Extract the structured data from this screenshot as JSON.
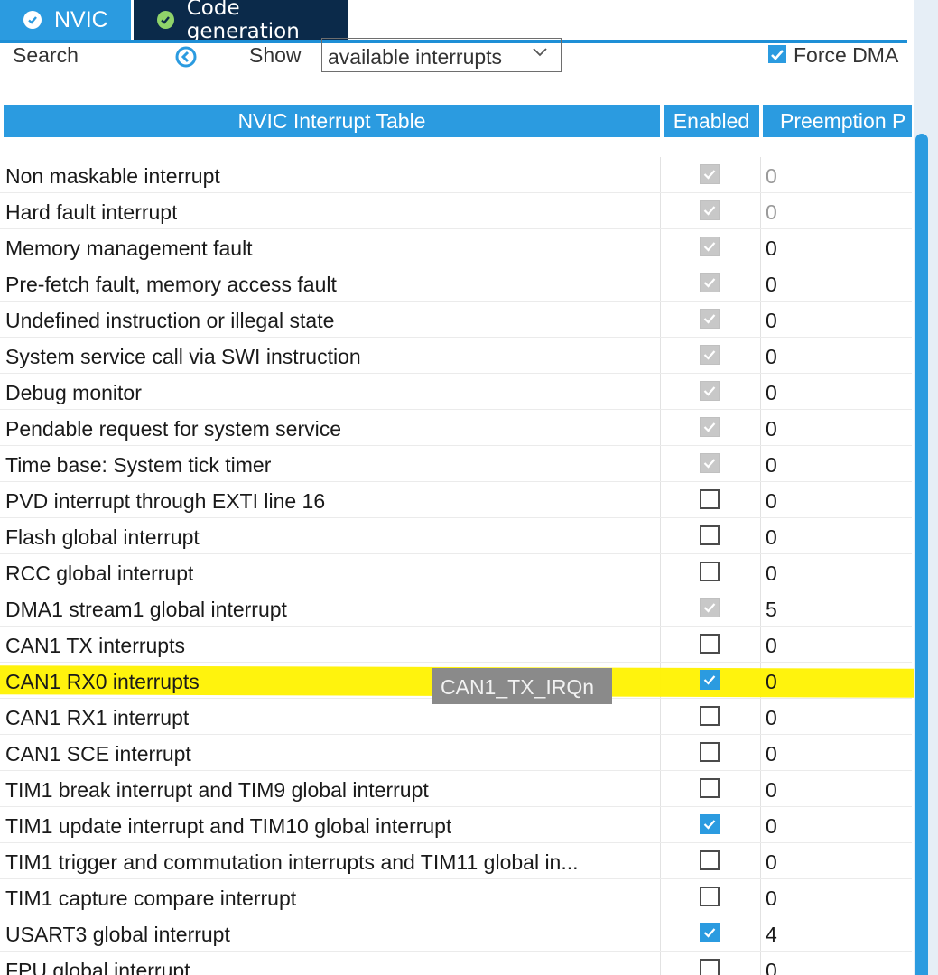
{
  "tabs": [
    {
      "label": "NVIC",
      "icon": "check-circle-icon"
    },
    {
      "label": "Code generation",
      "icon": "check-circle-icon"
    }
  ],
  "toolbar": {
    "search_label": "Search",
    "show_label": "Show",
    "show_value": "available interrupts",
    "force_dma_label": "Force DMA",
    "force_dma_checked": true
  },
  "table": {
    "headers": [
      "NVIC Interrupt Table",
      "Enabled",
      "Preemption P"
    ],
    "rows": [
      {
        "name": "Non maskable interrupt",
        "enabled": "disabled-checked",
        "priority": "0"
      },
      {
        "name": "Hard fault interrupt",
        "enabled": "disabled-checked",
        "priority": "0"
      },
      {
        "name": "Memory management fault",
        "enabled": "disabled-checked",
        "priority": "0"
      },
      {
        "name": "Pre-fetch fault, memory access fault",
        "enabled": "disabled-checked",
        "priority": "0"
      },
      {
        "name": "Undefined instruction or illegal state",
        "enabled": "disabled-checked",
        "priority": "0"
      },
      {
        "name": "System service call via SWI instruction",
        "enabled": "disabled-checked",
        "priority": "0"
      },
      {
        "name": "Debug monitor",
        "enabled": "disabled-checked",
        "priority": "0"
      },
      {
        "name": "Pendable request for system service",
        "enabled": "disabled-checked",
        "priority": "0"
      },
      {
        "name": "Time base: System tick timer",
        "enabled": "disabled-checked",
        "priority": "0"
      },
      {
        "name": "PVD interrupt through EXTI line 16",
        "enabled": "unchecked",
        "priority": "0"
      },
      {
        "name": "Flash global interrupt",
        "enabled": "unchecked",
        "priority": "0"
      },
      {
        "name": "RCC global interrupt",
        "enabled": "unchecked",
        "priority": "0"
      },
      {
        "name": "DMA1 stream1 global interrupt",
        "enabled": "disabled-checked",
        "priority": "5"
      },
      {
        "name": "CAN1 TX interrupts",
        "enabled": "unchecked",
        "priority": "0"
      },
      {
        "name": "CAN1 RX0 interrupts",
        "enabled": "checked",
        "priority": "0"
      },
      {
        "name": "CAN1 RX1 interrupt",
        "enabled": "unchecked",
        "priority": "0"
      },
      {
        "name": "CAN1 SCE interrupt",
        "enabled": "unchecked",
        "priority": "0"
      },
      {
        "name": "TIM1 break interrupt and TIM9 global interrupt",
        "enabled": "unchecked",
        "priority": "0"
      },
      {
        "name": "TIM1 update interrupt and TIM10 global interrupt",
        "enabled": "checked",
        "priority": "0"
      },
      {
        "name": "TIM1 trigger and commutation interrupts and TIM11 global in...",
        "enabled": "unchecked",
        "priority": "0"
      },
      {
        "name": "TIM1 capture compare interrupt",
        "enabled": "unchecked",
        "priority": "0"
      },
      {
        "name": "USART3 global interrupt",
        "enabled": "checked",
        "priority": "4"
      },
      {
        "name": "FPU global interrupt",
        "enabled": "unchecked",
        "priority": "0"
      }
    ]
  },
  "tooltip": "CAN1_TX_IRQn",
  "colors": {
    "accent": "#2b9be0",
    "dark_tab": "#0b2a4a",
    "highlight": "#fff200",
    "tab_check": "#8fd36a"
  }
}
